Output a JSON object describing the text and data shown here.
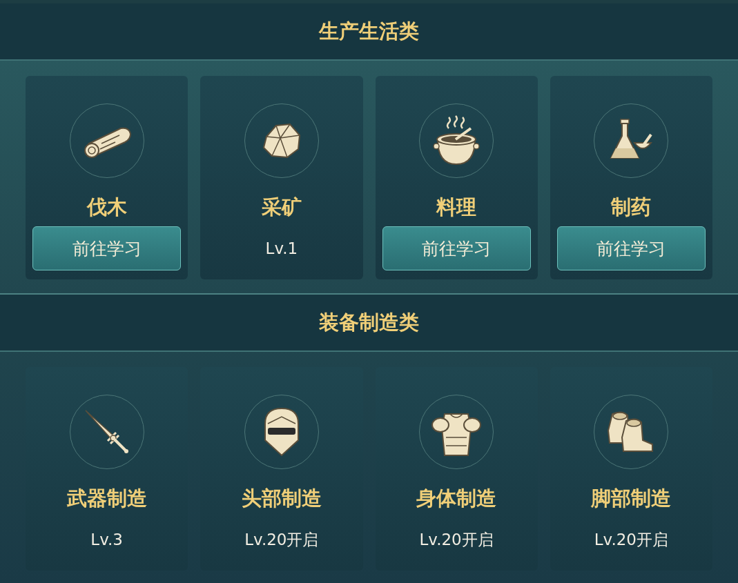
{
  "sections": [
    {
      "title": "生产生活类",
      "items": [
        {
          "name": "伐木",
          "kind": "button",
          "label": "前往学习"
        },
        {
          "name": "采矿",
          "kind": "level",
          "label": "Lv.1"
        },
        {
          "name": "料理",
          "kind": "button",
          "label": "前往学习"
        },
        {
          "name": "制药",
          "kind": "button",
          "label": "前往学习"
        }
      ]
    },
    {
      "title": "装备制造类",
      "items": [
        {
          "name": "武器制造",
          "kind": "level",
          "label": "Lv.3"
        },
        {
          "name": "头部制造",
          "kind": "level",
          "label": "Lv.20开启"
        },
        {
          "name": "身体制造",
          "kind": "level",
          "label": "Lv.20开启"
        },
        {
          "name": "脚部制造",
          "kind": "level",
          "label": "Lv.20开启"
        }
      ]
    }
  ]
}
